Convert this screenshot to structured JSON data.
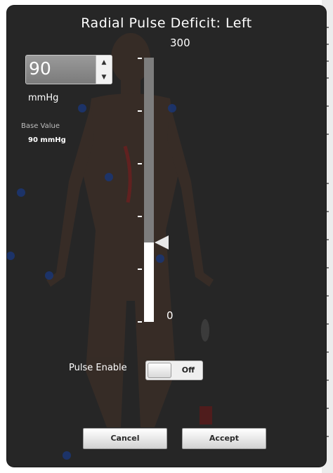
{
  "dialog": {
    "title": "Radial Pulse Deficit: Left"
  },
  "value_input": {
    "value": "90",
    "unit": "mmHg",
    "increment_icon": "triangle-up-icon",
    "decrement_icon": "triangle-down-icon"
  },
  "base": {
    "label": "Base Value",
    "value": "90 mmHg"
  },
  "slider": {
    "max_label": "300",
    "min_label": "0",
    "current_value": 90,
    "max": 300,
    "min": 0
  },
  "pulse_enable": {
    "label": "Pulse Enable",
    "state": "Off"
  },
  "buttons": {
    "cancel": "Cancel",
    "accept": "Accept"
  },
  "colors": {
    "dialog_bg": "#262626",
    "slider_track": "#7d7d7d",
    "slider_fill": "#ffffff"
  }
}
